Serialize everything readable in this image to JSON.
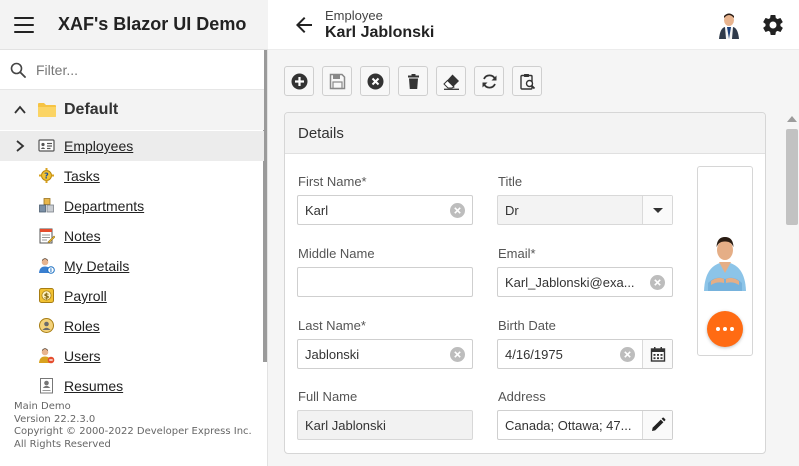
{
  "header": {
    "app_title": "XAF's Blazor UI Demo",
    "view_caption": "Employee",
    "record_name": "Karl Jablonski"
  },
  "sidebar": {
    "filter_placeholder": "Filter...",
    "group_label": "Default",
    "items": [
      {
        "label": "Employees",
        "icon": "employee-card-icon",
        "selected": true
      },
      {
        "label": "Tasks",
        "icon": "tasks-icon"
      },
      {
        "label": "Departments",
        "icon": "departments-icon"
      },
      {
        "label": "Notes",
        "icon": "notes-icon"
      },
      {
        "label": "My Details",
        "icon": "my-details-icon"
      },
      {
        "label": "Payroll",
        "icon": "payroll-icon"
      },
      {
        "label": "Roles",
        "icon": "roles-icon"
      },
      {
        "label": "Users",
        "icon": "users-icon"
      },
      {
        "label": "Resumes",
        "icon": "resumes-icon"
      }
    ],
    "about": {
      "line1": "Main Demo",
      "line2": "Version 22.2.3.0",
      "line3": "Copyright © 2000-2022 Developer Express Inc.",
      "line4": "All Rights Reserved"
    }
  },
  "toolbar": {
    "buttons": [
      "new",
      "save",
      "cancel",
      "delete",
      "reset-view-settings",
      "refresh",
      "export"
    ]
  },
  "details": {
    "title": "Details",
    "first_name": {
      "label": "First Name*",
      "value": "Karl"
    },
    "title_field": {
      "label": "Title",
      "value": "Dr"
    },
    "middle_name": {
      "label": "Middle Name",
      "value": ""
    },
    "email": {
      "label": "Email*",
      "value": "Karl_Jablonski@exa..."
    },
    "last_name": {
      "label": "Last Name*",
      "value": "Jablonski"
    },
    "birth_date": {
      "label": "Birth Date",
      "value": "4/16/1975"
    },
    "full_name": {
      "label": "Full Name",
      "value": "Karl Jablonski"
    },
    "address": {
      "label": "Address",
      "value": "Canada; Ottawa; 47..."
    }
  },
  "colors": {
    "accent": "#ff6b13",
    "sidebar_bg": "#f3f3f3",
    "folder": "#f6c343"
  }
}
